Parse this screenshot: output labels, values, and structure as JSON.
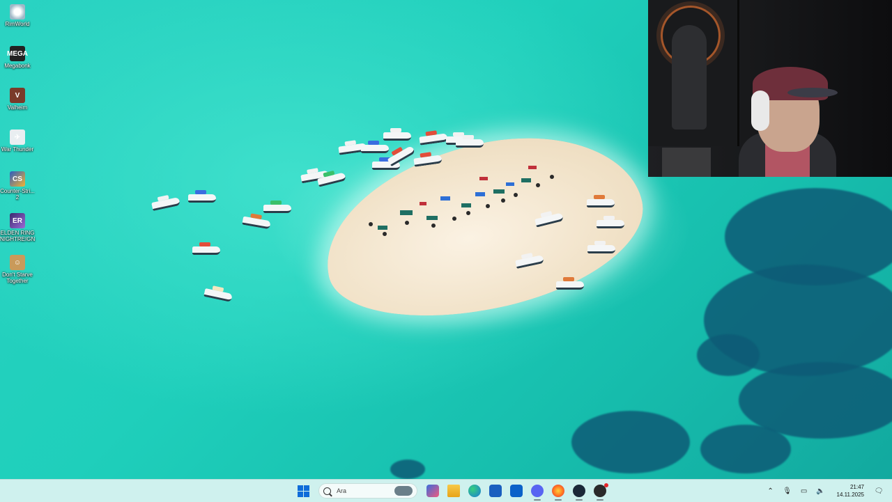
{
  "desktop": {
    "icons": [
      {
        "name": "RimWorld",
        "label": "RimWorld",
        "glyph": "◎"
      },
      {
        "name": "Megabonk",
        "label": "Megabonk",
        "glyph": "MEGA"
      },
      {
        "name": "Valheim",
        "label": "Valheim",
        "glyph": "V"
      },
      {
        "name": "War Thunder",
        "label": "War Thunder",
        "glyph": "✈"
      },
      {
        "name": "Counter-Strike 2",
        "label": "Counter-Stri...\n2",
        "glyph": "CS"
      },
      {
        "name": "ELDEN RING NIGHTREIGN",
        "label": "ELDEN RING\nNIGHTREIGN",
        "glyph": "ER"
      },
      {
        "name": "Don't Starve Together",
        "label": "Don't Starve\nTogether",
        "glyph": "☺"
      }
    ]
  },
  "taskbar": {
    "search_placeholder": "Ara",
    "apps": [
      {
        "name": "Start",
        "icon": "windows-logo-icon"
      },
      {
        "name": "Widgets",
        "icon": "widgets-icon"
      },
      {
        "name": "File Explorer",
        "icon": "folder-icon"
      },
      {
        "name": "Microsoft Edge",
        "icon": "edge-icon"
      },
      {
        "name": "Microsoft Store",
        "icon": "store-icon"
      },
      {
        "name": "Outlook",
        "icon": "outlook-icon"
      },
      {
        "name": "Discord",
        "icon": "discord-icon"
      },
      {
        "name": "Firefox",
        "icon": "firefox-icon"
      },
      {
        "name": "Steam",
        "icon": "steam-icon"
      },
      {
        "name": "OBS Studio",
        "icon": "obs-icon"
      }
    ],
    "tray": {
      "time": "21:47",
      "date": "14.11.2025"
    }
  }
}
